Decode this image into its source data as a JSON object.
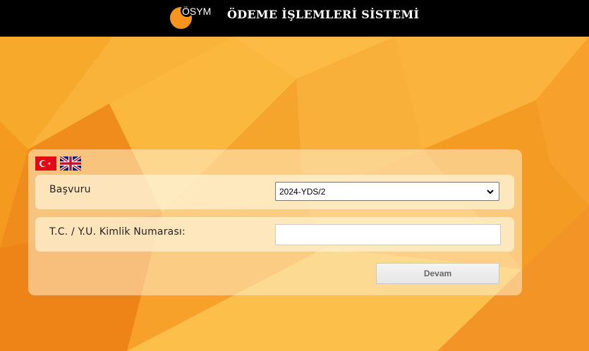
{
  "header": {
    "logo_text": "ÖSYM",
    "title": "ÖDEME İŞLEMLERİ SİSTEMİ"
  },
  "languages": [
    {
      "code": "tr",
      "icon": "turkish-flag-icon"
    },
    {
      "code": "en",
      "icon": "uk-flag-icon"
    }
  ],
  "form": {
    "application_label": "Başvuru",
    "application_selected": "2024-YDS/2",
    "id_label": "T.C. / Y.U. Kimlik Numarası:",
    "id_value": "",
    "submit_label": "Devam"
  },
  "colors": {
    "header_bg": "#000000",
    "brand_orange": "#f7941d",
    "background_orange": "#f5a623"
  }
}
